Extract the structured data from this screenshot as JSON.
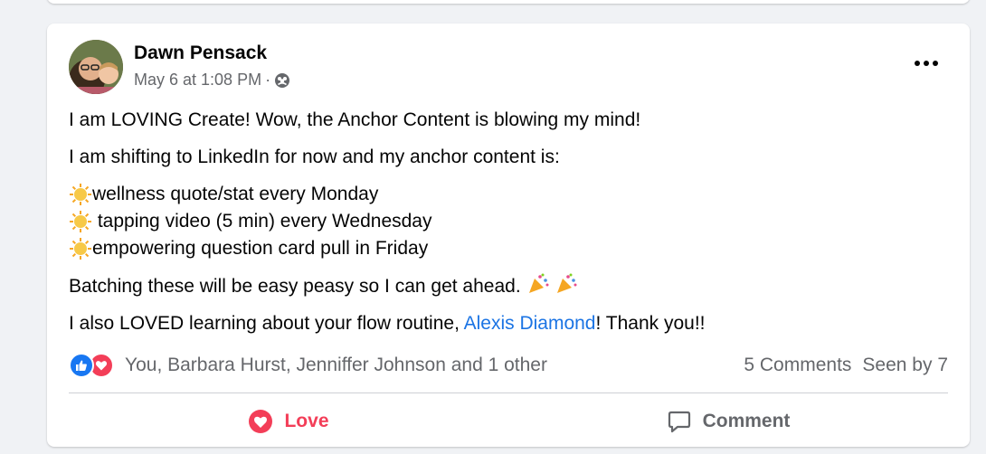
{
  "post": {
    "author": "Dawn Pensack",
    "timestamp": "May 6 at 1:08 PM",
    "separator": "·",
    "audience_icon": "group-icon",
    "paragraphs": {
      "p1": "I am LOVING Create! Wow, the Anchor Content is blowing my mind!",
      "p2": "I am shifting to LinkedIn for now and my anchor content is:",
      "list": [
        "wellness quote/stat every Monday",
        " tapping video (5 min) every Wednesday",
        "empowering question card pull in Friday"
      ],
      "p3": "Batching these will be easy peasy so I can get ahead.",
      "p4_before": "I also LOVED learning about your flow routine, ",
      "p4_mention": "Alexis Diamond",
      "p4_after": "! Thank you!!"
    }
  },
  "reactions": {
    "names": "You, Barbara Hurst, Jenniffer Johnson and 1 other",
    "icons": [
      "like-icon",
      "love-icon"
    ],
    "comments": "5 Comments",
    "seen": "Seen by 7"
  },
  "actions": {
    "love_label": "Love",
    "comment_label": "Comment"
  },
  "colors": {
    "mention": "#1b74e4",
    "love": "#f33e58",
    "like": "#1877f2",
    "secondary_text": "#65676b"
  }
}
